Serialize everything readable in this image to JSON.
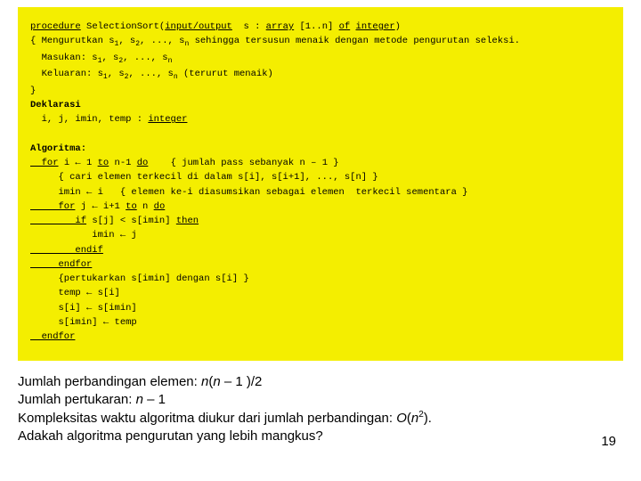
{
  "code": {
    "l1a": "procedure",
    "l1b": " SelectionSort(",
    "l1c": "input/output",
    "l1d": "  s : ",
    "l1e": "array",
    "l1f": " [1..n] ",
    "l1g": "of",
    "l1h": " ",
    "l1i": "integer",
    "l1j": ")",
    "l2a": "{ Mengurutkan s",
    "l2s1": "1",
    "l2b": ", s",
    "l2s2": "2",
    "l2c": ", ..., s",
    "l2sn": "n",
    "l2d": " sehingga tersusun menaik dengan metode pengurutan seleksi.",
    "l3a": "  Masukan: s",
    "l3b": ", s",
    "l3c": ", ..., s",
    "l4a": "  Keluaran: s",
    "l4b": ", s",
    "l4c": ", ..., s",
    "l4d": " (terurut menaik)",
    "l5": "}",
    "dekl": "Deklarasi",
    "l6a": "  i, j, imin, temp : ",
    "l6b": "integer",
    "algo": "Algoritma:",
    "l7a": "  for",
    "l7b": " i ← 1 ",
    "l7c": "to",
    "l7d": " n-1 ",
    "l7e": "do",
    "l7f": "    { jumlah pass sebanyak n – 1 }",
    "l8": "     { cari elemen terkecil di dalam s[i], s[i+1], ..., s[n] }",
    "l9": "     imin ← i   { elemen ke-i diasumsikan sebagai elemen  terkecil sementara }",
    "l10a": "     for",
    "l10b": " j ← i+1 ",
    "l10c": "to",
    "l10d": " n ",
    "l10e": "do",
    "l11a": "        if",
    "l11b": " s[j] < s[imin] ",
    "l11c": "then",
    "l12": "           imin ← j",
    "l13": "        endif",
    "l14": "     endfor",
    "l15": "     {pertukarkan s[imin] dengan s[i] }",
    "l16": "     temp ← s[i]",
    "l17": "     s[i] ← s[imin]",
    "l18": "     s[imin] ← temp",
    "l19": "  endfor"
  },
  "notes": {
    "p1a": "Jumlah perbandingan elemen: ",
    "p1b": "n",
    "p1c": "(",
    "p1d": "n",
    "p1e": " – 1 )/2",
    "p2a": "Jumlah pertukaran: ",
    "p2b": "n",
    "p2c": " – 1",
    "p3a": "Kompleksitas waktu algoritma diukur dari jumlah perbandingan: ",
    "p3b": "O",
    "p3c": "(",
    "p3d": "n",
    "p3e": "2",
    "p3f": ").",
    "p4": "Adakah algoritma pengurutan yang lebih mangkus?"
  },
  "page": "19"
}
